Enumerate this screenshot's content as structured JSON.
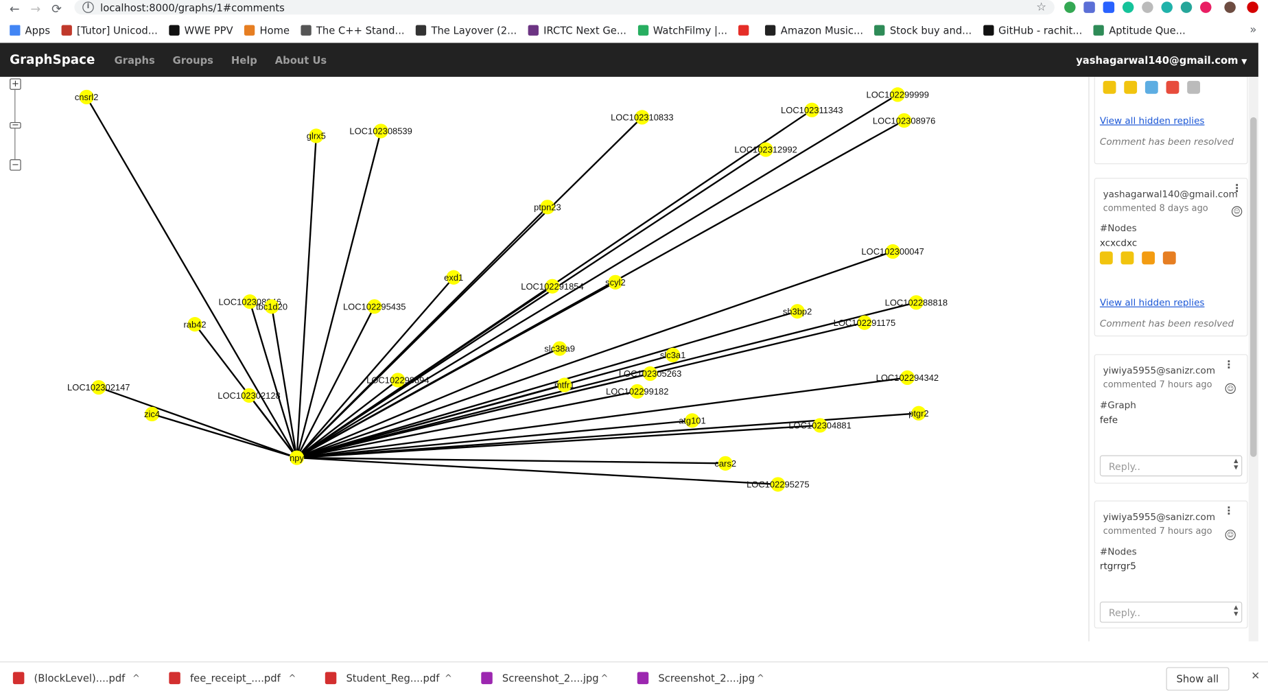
{
  "browser": {
    "url": "localhost:8000/graphs/1#comments",
    "info_glyph": "i",
    "star_glyph": "☆",
    "back_glyph": "←",
    "forward_glyph": "→",
    "reload_glyph": "⟳",
    "bookmarks": [
      {
        "label": "Apps",
        "color": "#4285f4"
      },
      {
        "label": "[Tutor] Unicod...",
        "color": "#c0392b"
      },
      {
        "label": "WWE PPV",
        "color": "#111111"
      },
      {
        "label": "Home",
        "color": "#e67e22"
      },
      {
        "label": "The C++ Stand...",
        "color": "#555555"
      },
      {
        "label": "The Layover (2...",
        "color": "#333333"
      },
      {
        "label": "IRCTC Next Ge...",
        "color": "#6c3483"
      },
      {
        "label": "WatchFilmy |...",
        "color": "#27ae60"
      },
      {
        "label": "",
        "color": "#e52d27"
      },
      {
        "label": "Amazon Music...",
        "color": "#222222"
      },
      {
        "label": "Stock buy and...",
        "color": "#2e8b57"
      },
      {
        "label": "GitHub - rachit...",
        "color": "#111111"
      },
      {
        "label": "Aptitude Que...",
        "color": "#2e8b57"
      }
    ],
    "more_glyph": "»"
  },
  "navbar": {
    "brand": "GraphSpace",
    "links": [
      "Graphs",
      "Groups",
      "Help",
      "About Us"
    ],
    "user": "yashagarwal140@gmail.com",
    "caret": "▼"
  },
  "zoom": {
    "plus": "+",
    "minus": "−"
  },
  "graph": {
    "node_color": "#ffff00",
    "edge_color": "#000000",
    "hub": "npy",
    "nodes": [
      {
        "id": "npy"
      },
      {
        "id": "cnsrl2",
        "label": "cnsrl2"
      },
      {
        "id": "glrx5",
        "label": "glrx5"
      },
      {
        "id": "LOC102308539",
        "label": "LOC102308539"
      },
      {
        "id": "LOC102310833",
        "label": "LOC102310833"
      },
      {
        "id": "LOC102311343",
        "label": "LOC102311343"
      },
      {
        "id": "LOC102299999",
        "label": "LOC102299999"
      },
      {
        "id": "LOC102308976",
        "label": "LOC102308976"
      },
      {
        "id": "LOC102312992",
        "label": "LOC102312992"
      },
      {
        "id": "ptpn23",
        "label": "ptpn23"
      },
      {
        "id": "exd1",
        "label": "exd1"
      },
      {
        "id": "LOC102291854",
        "label": "LOC102291854"
      },
      {
        "id": "scyl2",
        "label": "scyl2"
      },
      {
        "id": "LOC102300047",
        "label": "LOC102300047"
      },
      {
        "id": "LOC102308046",
        "label": "LOC102308046"
      },
      {
        "id": "tbc1d20",
        "label": "tbc1d20"
      },
      {
        "id": "rab42",
        "label": "rab42"
      },
      {
        "id": "LOC102295435",
        "label": "LOC102295435"
      },
      {
        "id": "sh3bp2",
        "label": "sh3bp2"
      },
      {
        "id": "LOC102288818",
        "label": "LOC102288818"
      },
      {
        "id": "LOC102291175",
        "label": "LOC102291175"
      },
      {
        "id": "slc38a9",
        "label": "slc38a9"
      },
      {
        "id": "slc3a1",
        "label": "slc3a1"
      },
      {
        "id": "LOC102305263",
        "label": "LOC102305263"
      },
      {
        "id": "LOC102302147",
        "label": "LOC102302147"
      },
      {
        "id": "LOC102298894",
        "label": "LOC102298894"
      },
      {
        "id": "mtfr1",
        "label": "mtfr1"
      },
      {
        "id": "LOC102299182",
        "label": "LOC102299182"
      },
      {
        "id": "LOC102294342",
        "label": "LOC102294342"
      },
      {
        "id": "LOC102302128",
        "label": "LOC102302128"
      },
      {
        "id": "zic4",
        "label": "zic4"
      },
      {
        "id": "ptgr2",
        "label": "ptgr2"
      },
      {
        "id": "atg101",
        "label": "atg101"
      },
      {
        "id": "LOC102304881",
        "label": "LOC102304881"
      },
      {
        "id": "cars2",
        "label": "cars2"
      },
      {
        "id": "LOC102295275",
        "label": "LOC102295275"
      }
    ],
    "edges": [
      [
        "npy",
        "cnsrl2"
      ],
      [
        "npy",
        "glrx5"
      ],
      [
        "npy",
        "LOC102308539"
      ],
      [
        "npy",
        "LOC102310833"
      ],
      [
        "npy",
        "LOC102311343"
      ],
      [
        "npy",
        "LOC102299999"
      ],
      [
        "npy",
        "LOC102308976"
      ],
      [
        "npy",
        "LOC102312992"
      ],
      [
        "npy",
        "ptpn23"
      ],
      [
        "npy",
        "exd1"
      ],
      [
        "npy",
        "LOC102291854"
      ],
      [
        "npy",
        "scyl2"
      ],
      [
        "npy",
        "LOC102300047"
      ],
      [
        "npy",
        "LOC102308046"
      ],
      [
        "npy",
        "tbc1d20"
      ],
      [
        "npy",
        "rab42"
      ],
      [
        "npy",
        "LOC102295435"
      ],
      [
        "npy",
        "sh3bp2"
      ],
      [
        "npy",
        "LOC102288818"
      ],
      [
        "npy",
        "LOC102291175"
      ],
      [
        "npy",
        "slc38a9"
      ],
      [
        "npy",
        "slc3a1"
      ],
      [
        "npy",
        "LOC102305263"
      ],
      [
        "npy",
        "LOC102302147"
      ],
      [
        "npy",
        "LOC102298894"
      ],
      [
        "npy",
        "mtfr1"
      ],
      [
        "npy",
        "LOC102299182"
      ],
      [
        "npy",
        "LOC102294342"
      ],
      [
        "npy",
        "LOC102302128"
      ],
      [
        "npy",
        "zic4"
      ],
      [
        "npy",
        "ptgr2"
      ],
      [
        "npy",
        "atg101"
      ],
      [
        "npy",
        "LOC102304881"
      ],
      [
        "npy",
        "cars2"
      ],
      [
        "npy",
        "LOC102295275"
      ]
    ]
  },
  "comments": {
    "cards": [
      {
        "view_hidden": "View all hidden replies",
        "resolved": "Comment has been resolved",
        "reactions": [
          "#f1c40f",
          "#f1c40f",
          "#5dade2",
          "#e74c3c",
          "#bbbbbb"
        ]
      },
      {
        "author": "yashagarwal140@gmail.com",
        "when": "commented 8 days ago",
        "tag": "#Nodes",
        "body": "xcxcdxc",
        "reactions": [
          "#f1c40f",
          "#f1c40f",
          "#f39c12",
          "#e67e22"
        ],
        "view_hidden": "View all hidden replies",
        "resolved": "Comment has been resolved"
      },
      {
        "author": "yiwiya5955@sanizr.com",
        "when": "commented 7 hours ago",
        "tag": "#Graph",
        "body": "fefe",
        "reply_placeholder": "Reply.."
      },
      {
        "author": "yiwiya5955@sanizr.com",
        "when": "commented 7 hours ago",
        "tag": "#Nodes",
        "body": "rtgrrgr5",
        "reply_placeholder": "Reply.."
      }
    ],
    "kebab": "⋮",
    "smile": "☺",
    "spin_up": "▲",
    "spin_down": "▼"
  },
  "downloads": {
    "files": [
      {
        "name": "(BlockLevel)....pdf",
        "color": "#d32f2f"
      },
      {
        "name": "fee_receipt_....pdf",
        "color": "#d32f2f"
      },
      {
        "name": "Student_Reg....pdf",
        "color": "#d32f2f"
      },
      {
        "name": "Screenshot_2....jpg",
        "color": "#9c27b0"
      },
      {
        "name": "Screenshot_2....jpg",
        "color": "#9c27b0"
      }
    ],
    "chevron": "^",
    "show_all": "Show all",
    "close": "✕"
  }
}
